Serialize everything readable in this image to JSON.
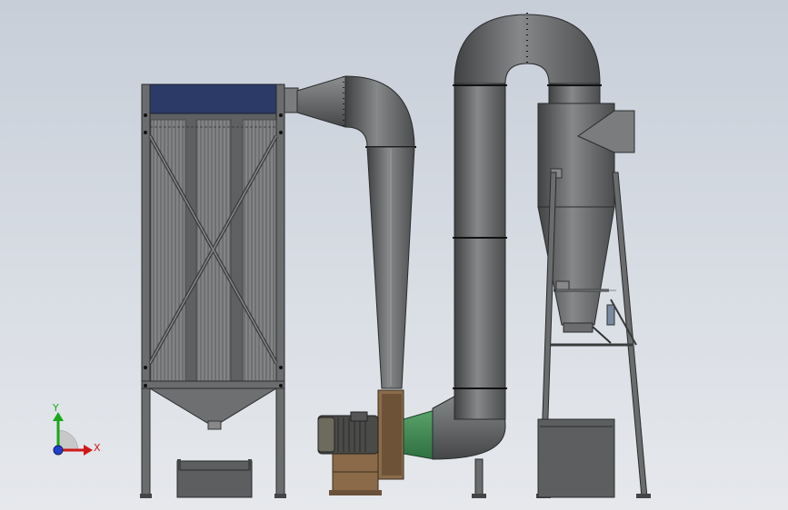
{
  "viewport": {
    "background": "#d3d8df"
  },
  "triad": {
    "y_label": "Y",
    "x_label": "X",
    "y_color": "#1aa81a",
    "x_color": "#d01818",
    "z_color": "#2040c8"
  },
  "colors": {
    "steel": "#6e7072",
    "steel_light": "#a9abad",
    "steel_dark": "#3c3d3f",
    "filter_header": "#2b3a66",
    "transition": "#3c8a52",
    "motor": "#4a4a48",
    "motor_base": "#8a6a48",
    "bin": "#5c5e60"
  },
  "objects": [
    "baghouse-filter",
    "filter-bags",
    "inlet-duct",
    "descending-duct",
    "centrifugal-fan",
    "fan-motor",
    "u-bend-duct",
    "cyclone-separator",
    "cyclone-support-frame",
    "collection-bin"
  ]
}
